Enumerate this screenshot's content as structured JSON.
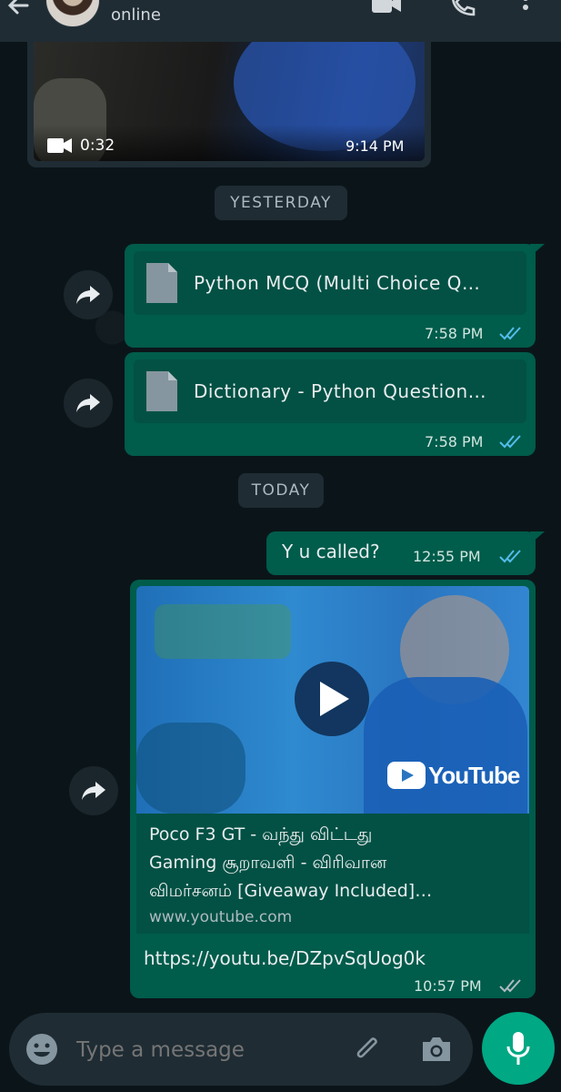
{
  "header": {
    "status": "online",
    "icons": [
      "back-arrow-icon",
      "video-call-icon",
      "phone-icon",
      "more-vert-icon"
    ]
  },
  "messages": {
    "video": {
      "duration": "0:32",
      "time": "9:14 PM"
    },
    "yesterday_label": "YESTERDAY",
    "doc1": {
      "name": "Python MCQ (Multi Choice Q…",
      "time": "7:58 PM"
    },
    "doc2": {
      "name": "Dictionary - Python Question…",
      "time": "7:58 PM"
    },
    "today_label": "TODAY",
    "text1": {
      "text": "Y u called?",
      "time": "12:55 PM"
    },
    "link": {
      "title_line1": "Poco F3 GT - வந்து விட்டது",
      "title_line2": "Gaming சூறாவளி - விரிவான",
      "title_line3": "விமர்சனம் [Giveaway Included]…",
      "domain": "www.youtube.com",
      "url": "https://youtu.be/DZpvSqUog0k",
      "time": "10:57 PM",
      "brand": "YouTube"
    }
  },
  "composer": {
    "placeholder": "Type a message"
  },
  "colors": {
    "bubble": "#005c4b",
    "header": "#1f2c34",
    "accent": "#00a884",
    "read_tick": "#53bdeb"
  }
}
